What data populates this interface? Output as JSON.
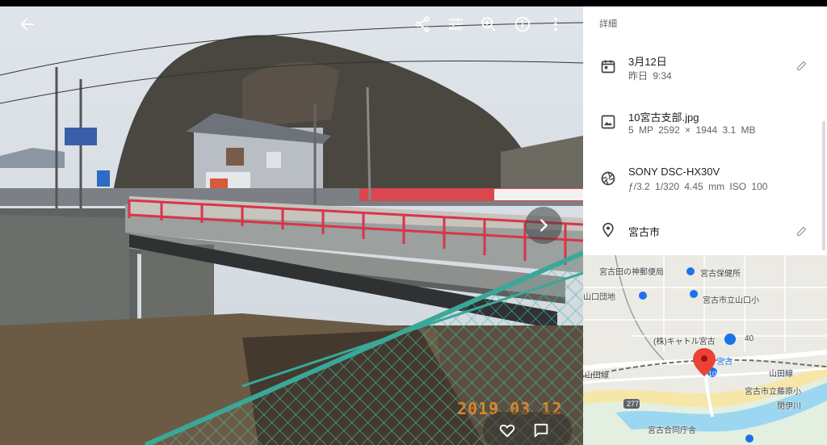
{
  "info_panel": {
    "title": "詳細",
    "date": {
      "icon": "calendar-icon",
      "main": "3月12日",
      "sub": "昨日 9:34"
    },
    "file": {
      "icon": "image-icon",
      "main": "10宮古支部.jpg",
      "sub": "5 MP   2592 × 1944   3.1 MB"
    },
    "camera": {
      "icon": "camera-aperture-icon",
      "main": "SONY DSC-HX30V",
      "sub": "ƒ/3.2   1/320   4.45 mm   ISO 100"
    },
    "location": {
      "icon": "location-pin-icon",
      "main": "宮古市"
    }
  },
  "viewer": {
    "datestamp": "2019 03 12",
    "toolbar_icons": [
      "back-arrow-icon",
      "share-icon",
      "tune-icon",
      "zoom-in-icon",
      "info-icon",
      "more-vert-icon"
    ],
    "bottom_icons": [
      "heart-icon",
      "comment-icon"
    ]
  },
  "map": {
    "labels": {
      "l1": "宮古田の神郵便局",
      "l2": "宮古保健所",
      "l3": "山口団地",
      "l4": "宮古市立山口小",
      "l5": "(株)キャトル宮古",
      "l6": "宮古合同庁舎",
      "l7": "宮古市立藤原小",
      "l8": "山田線",
      "l9": "山田線",
      "l10": "閉伊川",
      "l11": "宮古",
      "l12": "106",
      "l13": "277",
      "l14": "40"
    }
  },
  "colors": {
    "accent": "#1a73e8",
    "pin": "#ea4335",
    "river": "#9bd7f0"
  }
}
